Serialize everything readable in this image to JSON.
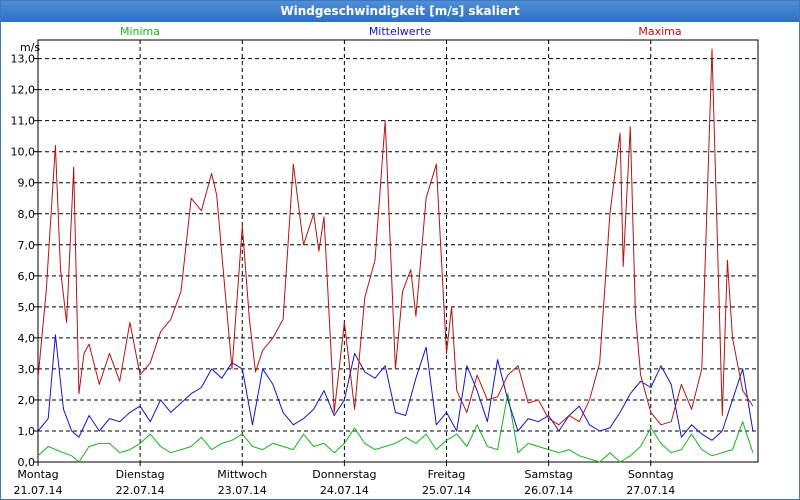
{
  "window": {
    "title": "Windgeschwindigkeit [m/s] skaliert"
  },
  "chart_data": {
    "type": "line",
    "ylabel": "m/s",
    "ylim": [
      0,
      13.6
    ],
    "yticks": [
      "0,0",
      "1,0",
      "2,0",
      "3,0",
      "4,0",
      "5,0",
      "6,0",
      "7,0",
      "8,0",
      "9,0",
      "10,0",
      "11,0",
      "12,0",
      "13,0"
    ],
    "grid": true,
    "days": [
      {
        "name": "Montag",
        "date": "21.07.14"
      },
      {
        "name": "Dienstag",
        "date": "22.07.14"
      },
      {
        "name": "Mittwoch",
        "date": "23.07.14"
      },
      {
        "name": "Donnerstag",
        "date": "24.07.14"
      },
      {
        "name": "Freitag",
        "date": "25.07.14"
      },
      {
        "name": "Samstag",
        "date": "26.07.14"
      },
      {
        "name": "Sonntag",
        "date": "27.07.14"
      }
    ],
    "x_start": 0,
    "x_end": 7.05,
    "series": [
      {
        "name": "Minima",
        "color": "#19b419",
        "x": [
          0,
          0.1,
          0.17,
          0.25,
          0.33,
          0.4,
          0.5,
          0.6,
          0.7,
          0.8,
          0.9,
          1.0,
          1.1,
          1.2,
          1.3,
          1.4,
          1.5,
          1.6,
          1.7,
          1.8,
          1.9,
          2.0,
          2.1,
          2.2,
          2.3,
          2.4,
          2.5,
          2.6,
          2.7,
          2.8,
          2.9,
          3.0,
          3.1,
          3.2,
          3.3,
          3.4,
          3.5,
          3.6,
          3.7,
          3.8,
          3.9,
          4.0,
          4.1,
          4.2,
          4.3,
          4.4,
          4.5,
          4.6,
          4.7,
          4.8,
          4.9,
          5.0,
          5.1,
          5.2,
          5.3,
          5.4,
          5.5,
          5.6,
          5.7,
          5.8,
          5.9,
          6.0,
          6.1,
          6.2,
          6.3,
          6.4,
          6.5,
          6.6,
          6.7,
          6.8,
          6.9,
          7.0
        ],
        "values": [
          0.2,
          0.5,
          0.4,
          0.3,
          0.2,
          0.0,
          0.5,
          0.6,
          0.6,
          0.3,
          0.4,
          0.6,
          0.9,
          0.5,
          0.3,
          0.4,
          0.5,
          0.8,
          0.4,
          0.6,
          0.7,
          0.9,
          0.5,
          0.4,
          0.6,
          0.5,
          0.4,
          0.9,
          0.5,
          0.6,
          0.3,
          0.6,
          1.1,
          0.6,
          0.4,
          0.5,
          0.6,
          0.8,
          0.6,
          0.9,
          0.4,
          0.7,
          0.9,
          0.5,
          1.2,
          0.5,
          0.4,
          2.2,
          0.3,
          0.6,
          0.5,
          0.4,
          0.3,
          0.4,
          0.2,
          0.1,
          0.0,
          0.3,
          0.0,
          0.2,
          0.5,
          1.1,
          0.6,
          0.3,
          0.4,
          0.9,
          0.4,
          0.2,
          0.3,
          0.4,
          1.3,
          0.3
        ]
      },
      {
        "name": "Mittelwerte",
        "color": "#1414c8",
        "x": [
          0,
          0.1,
          0.17,
          0.25,
          0.33,
          0.4,
          0.5,
          0.6,
          0.7,
          0.8,
          0.9,
          1.0,
          1.1,
          1.2,
          1.3,
          1.4,
          1.5,
          1.6,
          1.7,
          1.8,
          1.9,
          2.0,
          2.1,
          2.2,
          2.3,
          2.4,
          2.5,
          2.6,
          2.7,
          2.8,
          2.9,
          3.0,
          3.1,
          3.2,
          3.3,
          3.4,
          3.5,
          3.6,
          3.7,
          3.8,
          3.9,
          4.0,
          4.1,
          4.2,
          4.3,
          4.4,
          4.5,
          4.6,
          4.7,
          4.8,
          4.9,
          5.0,
          5.1,
          5.2,
          5.3,
          5.4,
          5.5,
          5.6,
          5.7,
          5.8,
          5.9,
          6.0,
          6.1,
          6.2,
          6.3,
          6.4,
          6.5,
          6.6,
          6.7,
          6.8,
          6.9,
          7.0
        ],
        "values": [
          1.0,
          1.4,
          4.1,
          1.7,
          1.0,
          0.8,
          1.5,
          1.0,
          1.4,
          1.3,
          1.6,
          1.8,
          1.3,
          2.0,
          1.6,
          1.9,
          2.2,
          2.4,
          3.0,
          2.7,
          3.2,
          3.0,
          1.2,
          3.0,
          2.5,
          1.6,
          1.2,
          1.4,
          1.7,
          2.3,
          1.5,
          2.0,
          3.5,
          2.9,
          2.7,
          3.1,
          1.6,
          1.5,
          2.7,
          3.7,
          1.2,
          1.6,
          1.0,
          3.1,
          2.3,
          1.3,
          3.3,
          2.0,
          1.0,
          1.4,
          1.3,
          1.5,
          1.0,
          1.5,
          1.8,
          1.2,
          1.0,
          1.1,
          1.6,
          2.2,
          2.6,
          2.4,
          3.1,
          2.5,
          0.8,
          1.2,
          0.9,
          0.7,
          1.0,
          2.0,
          3.0,
          1.0
        ]
      },
      {
        "name": "Maxima",
        "color": "#b41414",
        "x": [
          0,
          0.08,
          0.17,
          0.22,
          0.28,
          0.35,
          0.4,
          0.45,
          0.5,
          0.6,
          0.7,
          0.8,
          0.9,
          1.0,
          1.1,
          1.2,
          1.3,
          1.4,
          1.5,
          1.6,
          1.7,
          1.75,
          1.8,
          1.9,
          2.0,
          2.07,
          2.13,
          2.2,
          2.3,
          2.4,
          2.5,
          2.6,
          2.7,
          2.75,
          2.8,
          2.9,
          3.0,
          3.1,
          3.2,
          3.3,
          3.4,
          3.5,
          3.57,
          3.65,
          3.7,
          3.8,
          3.9,
          4.0,
          4.05,
          4.1,
          4.2,
          4.3,
          4.4,
          4.5,
          4.6,
          4.7,
          4.8,
          4.9,
          5.0,
          5.1,
          5.2,
          5.3,
          5.4,
          5.5,
          5.6,
          5.7,
          5.73,
          5.8,
          5.85,
          5.9,
          6.0,
          6.1,
          6.2,
          6.3,
          6.4,
          6.5,
          6.6,
          6.7,
          6.75,
          6.8,
          6.9,
          7.0
        ],
        "values": [
          2.7,
          5.5,
          10.2,
          6.2,
          4.5,
          9.5,
          2.2,
          3.5,
          3.8,
          2.5,
          3.5,
          2.6,
          4.5,
          2.8,
          3.2,
          4.2,
          4.6,
          5.5,
          8.5,
          8.1,
          9.3,
          8.6,
          6.7,
          3.0,
          7.6,
          4.6,
          2.9,
          3.6,
          4.0,
          4.6,
          9.6,
          7.0,
          8.0,
          6.8,
          7.9,
          1.6,
          4.5,
          1.7,
          5.3,
          6.5,
          11.0,
          3.0,
          5.5,
          6.2,
          4.7,
          8.5,
          9.6,
          3.5,
          5.0,
          2.3,
          1.6,
          2.8,
          2.0,
          2.1,
          2.8,
          3.1,
          1.9,
          2.0,
          1.4,
          1.2,
          1.5,
          1.3,
          2.0,
          3.2,
          8.0,
          10.6,
          6.3,
          10.8,
          4.8,
          2.8,
          1.6,
          1.2,
          1.3,
          2.5,
          1.7,
          3.0,
          13.3,
          1.5,
          6.5,
          4.0,
          2.3,
          1.8
        ]
      }
    ]
  }
}
